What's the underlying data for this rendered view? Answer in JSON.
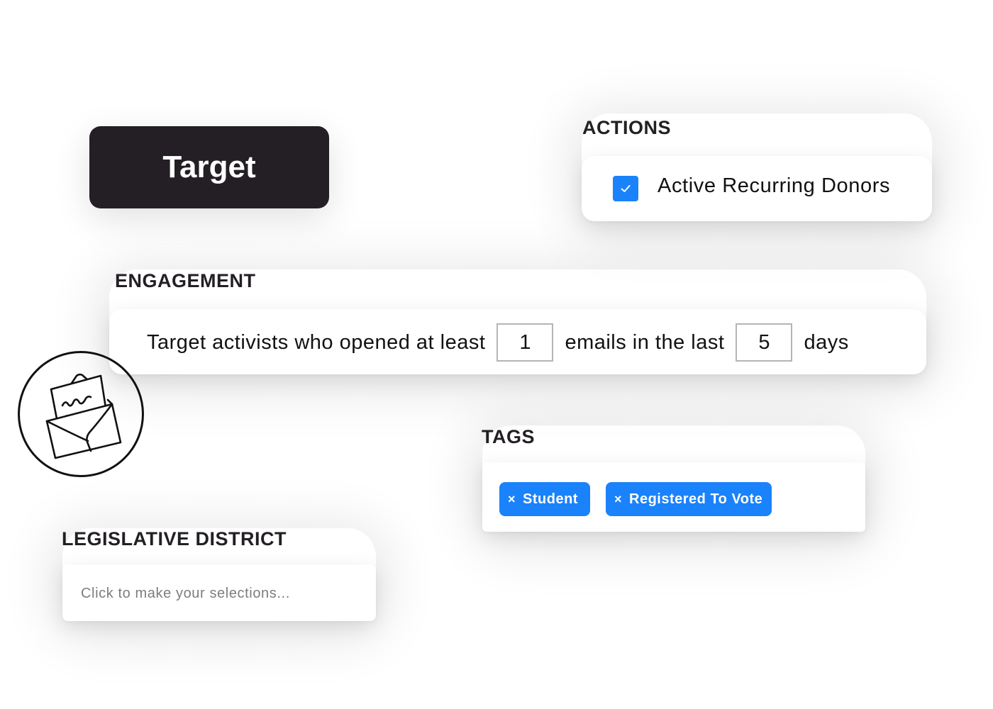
{
  "target_button": {
    "label": "Target"
  },
  "actions": {
    "heading": "ACTIONS",
    "items": [
      {
        "label": "Active Recurring Donors",
        "checked": true
      }
    ]
  },
  "engagement": {
    "heading": "ENGAGEMENT",
    "text_before": "Target activists who opened at least",
    "min_emails": "1",
    "text_middle": "emails in the last",
    "days": "5",
    "text_after": "days"
  },
  "illustration": {
    "icon": "envelope-letter-icon"
  },
  "tags": {
    "heading": "TAGS",
    "items": [
      {
        "label": "Student",
        "remove_glyph": "×"
      },
      {
        "label": "Registered To Vote",
        "remove_glyph": "×"
      }
    ]
  },
  "legislative_district": {
    "heading": "LEGISLATIVE DISTRICT",
    "placeholder": "Click to make your selections..."
  },
  "colors": {
    "accent": "#1a82fb",
    "dark": "#231f24",
    "text": "#111111",
    "placeholder": "#7d7d7d",
    "input_border": "#b5b5b5"
  }
}
